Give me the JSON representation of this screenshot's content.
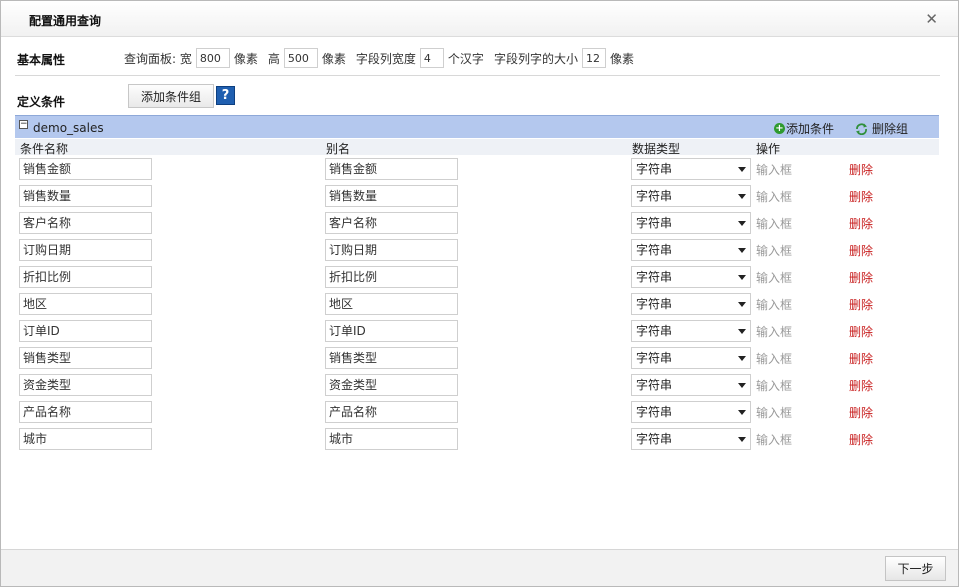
{
  "dialog": {
    "title": "配置通用查询",
    "close_icon": "close-icon ×"
  },
  "basic": {
    "label": "基本属性",
    "panel_label": "查询面板: 宽",
    "width_value": "800",
    "unit_px": "像素",
    "height_label": "高",
    "height_value": "500",
    "field_width_label": "字段列宽度",
    "field_width_value": "4",
    "field_width_unit": "个汉字",
    "font_size_label": "字段列字的大小",
    "font_size_value": "12",
    "font_size_unit": "像素"
  },
  "define": {
    "label": "定义条件",
    "add_group_button": "添加条件组",
    "help_label": "?"
  },
  "group": {
    "name": "demo_sales",
    "collapse_symbol": "−",
    "add_condition": "添加条件",
    "delete_group": "删除组"
  },
  "columns": {
    "name": "条件名称",
    "alias": "别名",
    "data_type": "数据类型",
    "operation": "操作"
  },
  "rows": [
    {
      "name": "销售金额",
      "alias": "销售金额",
      "type": "字符串",
      "input": "输入框",
      "delete": "删除"
    },
    {
      "name": "销售数量",
      "alias": "销售数量",
      "type": "字符串",
      "input": "输入框",
      "delete": "删除"
    },
    {
      "name": "客户名称",
      "alias": "客户名称",
      "type": "字符串",
      "input": "输入框",
      "delete": "删除"
    },
    {
      "name": "订购日期",
      "alias": "订购日期",
      "type": "字符串",
      "input": "输入框",
      "delete": "删除"
    },
    {
      "name": "折扣比例",
      "alias": "折扣比例",
      "type": "字符串",
      "input": "输入框",
      "delete": "删除"
    },
    {
      "name": "地区",
      "alias": "地区",
      "type": "字符串",
      "input": "输入框",
      "delete": "删除"
    },
    {
      "name": "订单ID",
      "alias": "订单ID",
      "type": "字符串",
      "input": "输入框",
      "delete": "删除"
    },
    {
      "name": "销售类型",
      "alias": "销售类型",
      "type": "字符串",
      "input": "输入框",
      "delete": "删除"
    },
    {
      "name": "资金类型",
      "alias": "资金类型",
      "type": "字符串",
      "input": "输入框",
      "delete": "删除"
    },
    {
      "name": "产品名称",
      "alias": "产品名称",
      "type": "字符串",
      "input": "输入框",
      "delete": "删除"
    },
    {
      "name": "城市",
      "alias": "城市",
      "type": "字符串",
      "input": "输入框",
      "delete": "删除"
    }
  ],
  "footer": {
    "next_button": "下一步"
  },
  "colors": {
    "group_bar": "#b4c8ee",
    "delete_link": "#c81e1e",
    "help_icon": "#1f5fb0"
  }
}
